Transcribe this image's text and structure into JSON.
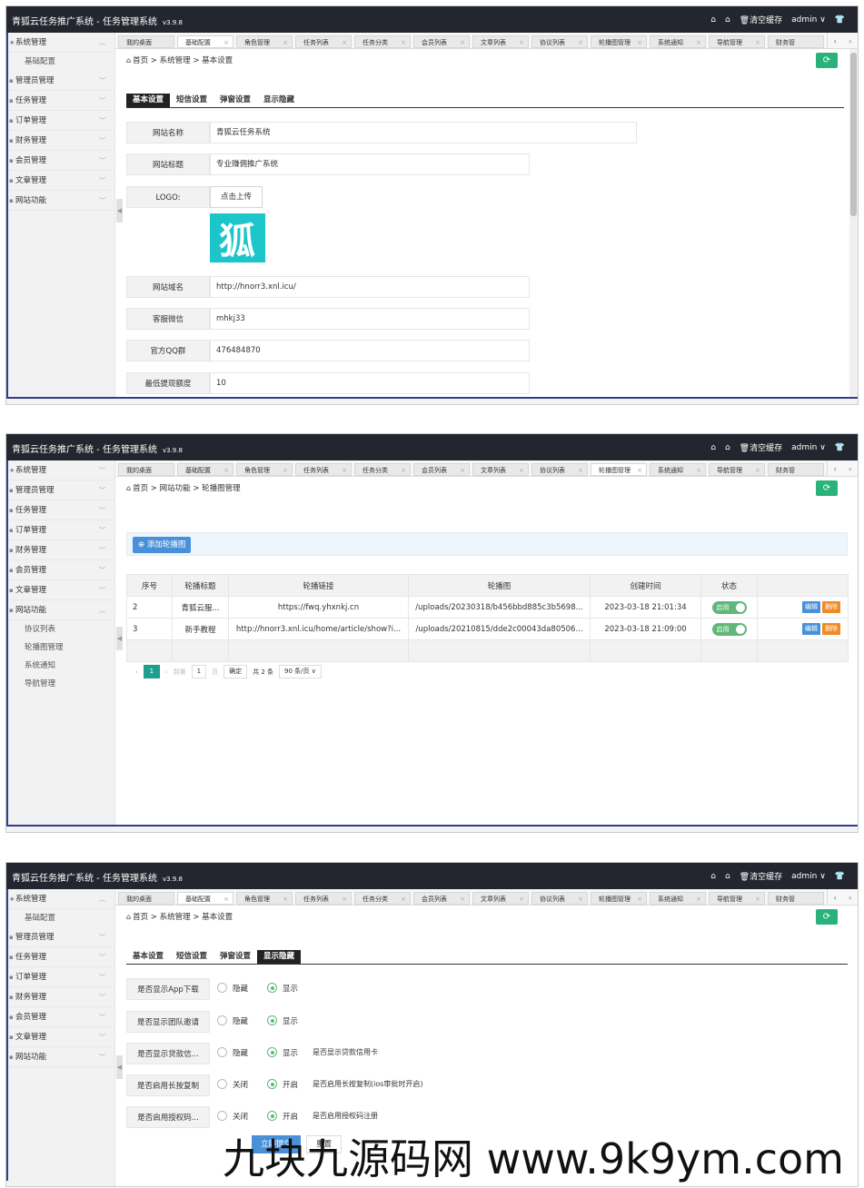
{
  "app": {
    "title": "青狐云任务推广系统 - 任务管理系统",
    "version": "v3.9.8"
  },
  "topbar": {
    "clear_cache": "清空缓存",
    "user": "admin"
  },
  "tabs": [
    "我的桌面",
    "基础配置",
    "角色管理",
    "任务列表",
    "任务分类",
    "会员列表",
    "文章列表",
    "协议列表",
    "轮播图管理",
    "系统通知",
    "导航管理",
    "财务管"
  ],
  "sidebar": {
    "items": [
      "系统管理",
      "管理员管理",
      "任务管理",
      "订单管理",
      "财务管理",
      "会员管理",
      "文章管理",
      "网站功能"
    ],
    "system_sub": [
      "基础配置"
    ],
    "website_sub": [
      "协议列表",
      "轮播图管理",
      "系统通知",
      "导航管理"
    ]
  },
  "breadcrumb1": {
    "home": "首页",
    "section": "系统管理",
    "page": "基本设置"
  },
  "breadcrumb2": {
    "home": "首页",
    "section": "网站功能",
    "page": "轮播图管理"
  },
  "settings_tabs": [
    "基本设置",
    "短信设置",
    "弹窗设置",
    "显示隐藏"
  ],
  "basic_form": {
    "site_name": {
      "label": "网站名称",
      "value": "青狐云任务系统"
    },
    "site_title": {
      "label": "网站标题",
      "value": "专业赚佣推广系统"
    },
    "logo": {
      "label": "LOGO:",
      "button": "点击上传",
      "text": "狐"
    },
    "site_domain": {
      "label": "网站域名",
      "value": "http://hnorr3.xnl.icu/"
    },
    "wechat": {
      "label": "客服微信",
      "value": "mhkj33"
    },
    "qq_group": {
      "label": "官方QQ群",
      "value": "476484870"
    },
    "min_withdraw": {
      "label": "最低提现额度",
      "value": "10"
    }
  },
  "banner": {
    "add_button": "添加轮播图",
    "columns": [
      "序号",
      "轮播标题",
      "轮播链接",
      "轮播图",
      "创建时间",
      "状态",
      ""
    ],
    "rows": [
      {
        "id": "2",
        "title": "青狐云服...",
        "link": "https://fwq.yhxnkj.cn",
        "image": "/uploads/20230318/b456bbd885c3b5698...",
        "created": "2023-03-18 21:01:34",
        "status": "启用",
        "edit": "编辑",
        "del": "删除"
      },
      {
        "id": "3",
        "title": "新手教程",
        "link": "http://hnorr3.xnl.icu/home/article/show?i...",
        "image": "/uploads/20210815/dde2c00043da80506...",
        "created": "2023-03-18 21:09:00",
        "status": "启用",
        "edit": "编辑",
        "del": "删除"
      }
    ],
    "pager": {
      "page": "1",
      "goto": "到第",
      "goto_value": "1",
      "page_unit": "页",
      "confirm": "确定",
      "total": "共 2 条",
      "per_page": "90 条/页"
    }
  },
  "display_form": {
    "rows": [
      {
        "label": "是否显示App下载",
        "off": "隐藏",
        "on": "显示",
        "hint": ""
      },
      {
        "label": "是否显示团队邀请",
        "off": "隐藏",
        "on": "显示",
        "hint": ""
      },
      {
        "label": "是否显示贷款信...",
        "off": "隐藏",
        "on": "显示",
        "hint": "是否显示贷款信用卡"
      },
      {
        "label": "是否启用长按复制",
        "off": "关闭",
        "on": "开启",
        "hint": "是否启用长按复制(ios审批时开启)"
      },
      {
        "label": "是否启用授权码...",
        "off": "关闭",
        "on": "开启",
        "hint": "是否启用授权码注册"
      }
    ],
    "submit": "立即提交",
    "reset": "重置"
  },
  "watermark": "九块九源码网 www.9k9ym.com",
  "colors": {
    "topbar": "#23262e",
    "accent_green": "#2ab27b",
    "primary_blue": "#4a90d9",
    "danger_orange": "#f08a24",
    "logo_cyan": "#1cc5c9"
  }
}
